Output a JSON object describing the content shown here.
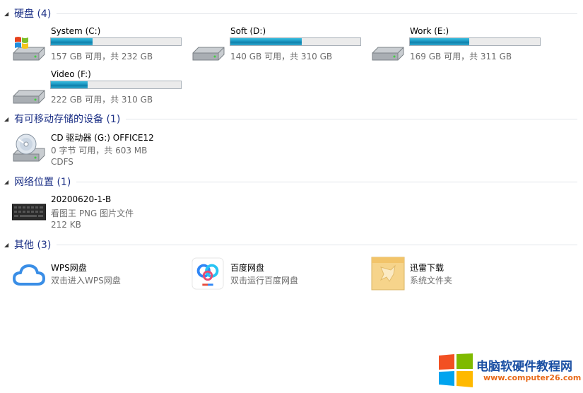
{
  "groups": {
    "hard_disks": {
      "header": "硬盘 (4)"
    },
    "removable": {
      "header": "有可移动存储的设备 (1)"
    },
    "network": {
      "header": "网络位置 (1)"
    },
    "other": {
      "header": "其他 (3)"
    }
  },
  "drives": [
    {
      "name": "System (C:)",
      "space": "157 GB 可用，共 232 GB",
      "free_gb": 157,
      "total_gb": 232
    },
    {
      "name": "Soft (D:)",
      "space": "140 GB 可用，共 310 GB",
      "free_gb": 140,
      "total_gb": 310
    },
    {
      "name": "Work (E:)",
      "space": "169 GB 可用，共 311 GB",
      "free_gb": 169,
      "total_gb": 311
    },
    {
      "name": "Video (F:)",
      "space": "222 GB 可用，共 310 GB",
      "free_gb": 222,
      "total_gb": 310
    }
  ],
  "cd_drive": {
    "name": "CD 驱动器 (G:) OFFICE12",
    "space": "0 字节 可用，共 603 MB",
    "fs": "CDFS"
  },
  "network_item": {
    "name": "20200620-1-B",
    "type": "看图王 PNG 图片文件",
    "size": "212 KB"
  },
  "others": [
    {
      "name": "WPS网盘",
      "desc": "双击进入WPS网盘"
    },
    {
      "name": "百度网盘",
      "desc": "双击运行百度网盘"
    },
    {
      "name": "迅雷下载",
      "desc": "系统文件夹"
    }
  ],
  "watermark": {
    "title": "电脑软硬件教程网",
    "url": "www.computer26.com"
  },
  "colors": {
    "header_text": "#1e3287",
    "bar_fill": "#1a95c0",
    "bar_bg": "#ebebeb"
  },
  "icons": {
    "system_drive": "windows-drive-icon",
    "drive": "hard-drive-icon",
    "cd": "cd-drive-icon",
    "network_file": "image-file-icon",
    "wps": "cloud-icon",
    "baidu": "baidu-netdisk-icon",
    "xunlei": "folder-bird-icon"
  }
}
